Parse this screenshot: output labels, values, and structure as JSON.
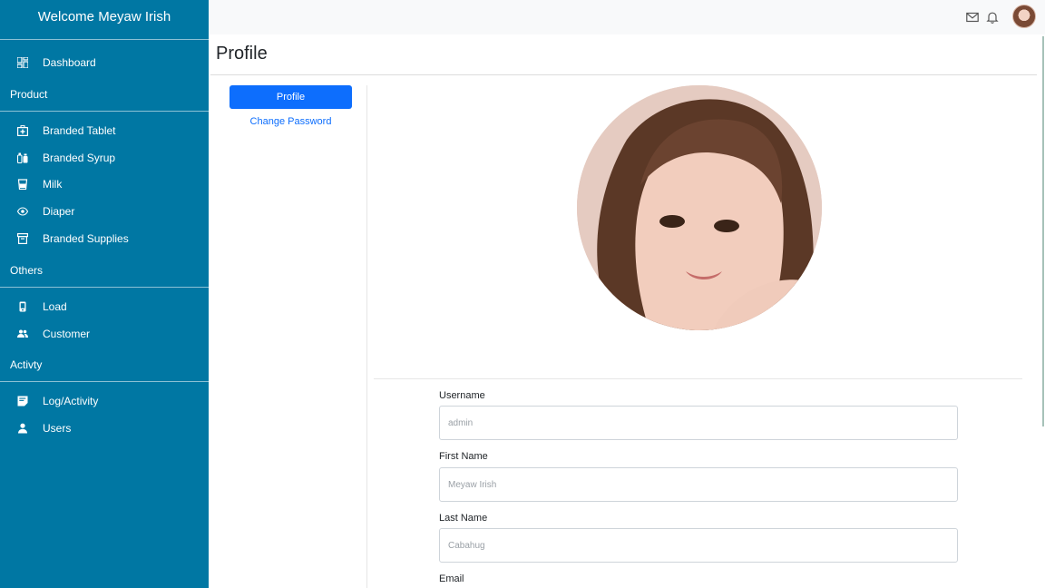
{
  "sidebar": {
    "title": "Welcome  Meyaw Irish",
    "items": [
      {
        "label": "Dashboard",
        "icon": "dashboard-icon"
      },
      {
        "label": "Branded Tablet",
        "icon": "medkit-icon"
      },
      {
        "label": "Branded Syrup",
        "icon": "syrup-icon"
      },
      {
        "label": "Milk",
        "icon": "milk-icon"
      },
      {
        "label": "Diaper",
        "icon": "eye-icon"
      },
      {
        "label": "Branded Supplies",
        "icon": "archive-icon"
      },
      {
        "label": "Load",
        "icon": "phone-icon"
      },
      {
        "label": "Customer",
        "icon": "people-icon"
      },
      {
        "label": "Log/Activity",
        "icon": "note-icon"
      },
      {
        "label": "Users",
        "icon": "user-icon"
      }
    ],
    "sections": [
      "Product",
      "Others",
      "Activty"
    ]
  },
  "topbar": {
    "icons": [
      "mail-icon",
      "bell-icon",
      "avatar"
    ]
  },
  "page": {
    "title": "Profile"
  },
  "tabs": {
    "profile_label": "Profile",
    "password_label": "Change Password"
  },
  "form": {
    "username": {
      "label": "Username",
      "placeholder": "admin"
    },
    "first_name": {
      "label": "First Name",
      "placeholder": "Meyaw Irish"
    },
    "last_name": {
      "label": "Last Name",
      "placeholder": "Cabahug"
    },
    "email": {
      "label": "Email"
    }
  },
  "colors": {
    "sidebar": "#0077a3",
    "primary": "#0d6efd"
  }
}
